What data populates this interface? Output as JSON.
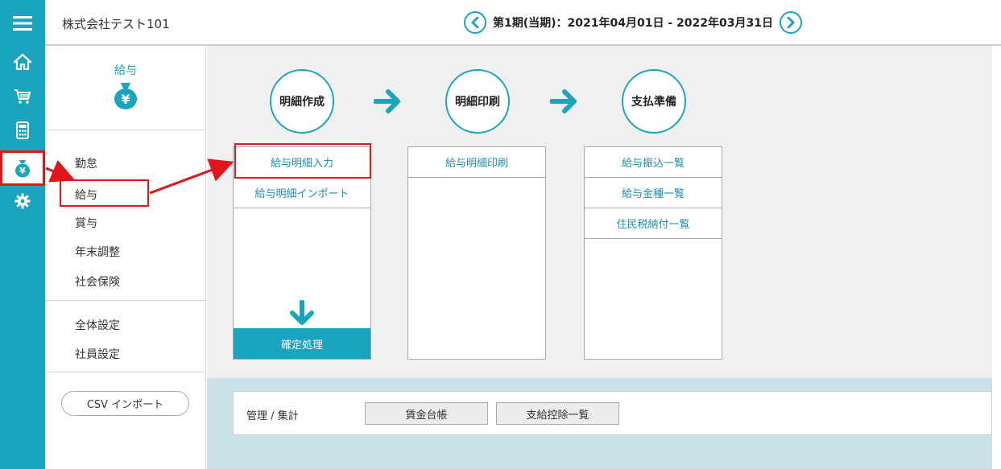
{
  "header": {
    "company": "株式会社テスト101",
    "period": "第1期(当期)：2021年04月01日 - 2022年03月31日"
  },
  "sidebar": {
    "title": "給与",
    "items": {
      "attendance": "勤怠",
      "salary": "給与",
      "bonus": "賞与",
      "year_end": "年末調整",
      "social_insurance": "社会保険",
      "general_settings": "全体設定",
      "employee_settings": "社員設定"
    },
    "csv_import": "CSV インポート"
  },
  "steps": [
    {
      "label": "明細作成"
    },
    {
      "label": "明細印刷"
    },
    {
      "label": "支払準備"
    }
  ],
  "panels": {
    "create": {
      "items": [
        "給与明細入力",
        "給与明細インポート"
      ],
      "confirm": "確定処理"
    },
    "print": {
      "items": [
        "給与明細印刷"
      ]
    },
    "payment": {
      "items": [
        "給与振込一覧",
        "給与金種一覧",
        "住民税納付一覧"
      ]
    }
  },
  "management": {
    "label": "管理 / 集計",
    "buttons": [
      "賃金台帳",
      "支給控除一覧"
    ]
  },
  "colors": {
    "accent": "#1aa4bd",
    "highlight": "#e0161b"
  }
}
